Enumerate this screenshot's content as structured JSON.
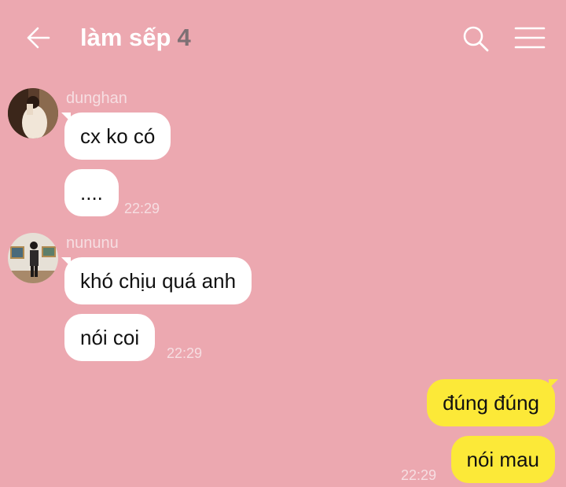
{
  "header": {
    "title": "làm sếp",
    "member_count": "4",
    "back_icon": "arrow-left-icon",
    "search_icon": "search-icon",
    "menu_icon": "hamburger-menu-icon"
  },
  "colors": {
    "background": "#eca8b0",
    "incoming_bubble": "#ffffff",
    "outgoing_bubble": "#fce938",
    "meta_text": "#f6dee2",
    "count_text": "#7d7074"
  },
  "messages": {
    "group1": {
      "sender": "dunghan",
      "m1": "cx ko có",
      "m2": "....",
      "time": "22:29"
    },
    "group2": {
      "sender": "nununu",
      "m1": "khó chịu quá anh",
      "m2": "nói coi",
      "time": "22:29"
    },
    "outgoing": {
      "m1": "đúng đúng",
      "m2": "nói mau",
      "time": "22:29"
    }
  }
}
